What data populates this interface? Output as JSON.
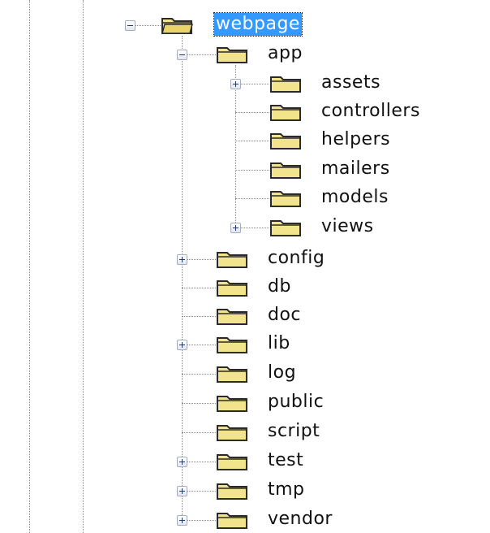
{
  "tree": {
    "root": {
      "label": "webpage",
      "expanded": true,
      "selected": true
    },
    "app": {
      "label": "app",
      "expanded": true,
      "children": [
        {
          "label": "assets",
          "has_children": true
        },
        {
          "label": "controllers",
          "has_children": false
        },
        {
          "label": "helpers",
          "has_children": false
        },
        {
          "label": "mailers",
          "has_children": false
        },
        {
          "label": "models",
          "has_children": false
        },
        {
          "label": "views",
          "has_children": true
        }
      ]
    },
    "siblings": [
      {
        "label": "config",
        "has_children": true
      },
      {
        "label": "db",
        "has_children": false
      },
      {
        "label": "doc",
        "has_children": false
      },
      {
        "label": "lib",
        "has_children": true
      },
      {
        "label": "log",
        "has_children": false
      },
      {
        "label": "public",
        "has_children": false
      },
      {
        "label": "script",
        "has_children": false
      },
      {
        "label": "test",
        "has_children": true
      },
      {
        "label": "tmp",
        "has_children": true
      },
      {
        "label": "vendor",
        "has_children": true
      }
    ]
  },
  "colors": {
    "selection": "#3399ff",
    "folder_fill": "#f2e48c",
    "folder_border": "#2a2a2a",
    "tree_line": "#8a8a8a"
  },
  "icons": {
    "expanded": "minus-expander-icon",
    "collapsed": "plus-expander-icon",
    "folder": "folder-icon",
    "open_folder": "folder-open-icon"
  }
}
